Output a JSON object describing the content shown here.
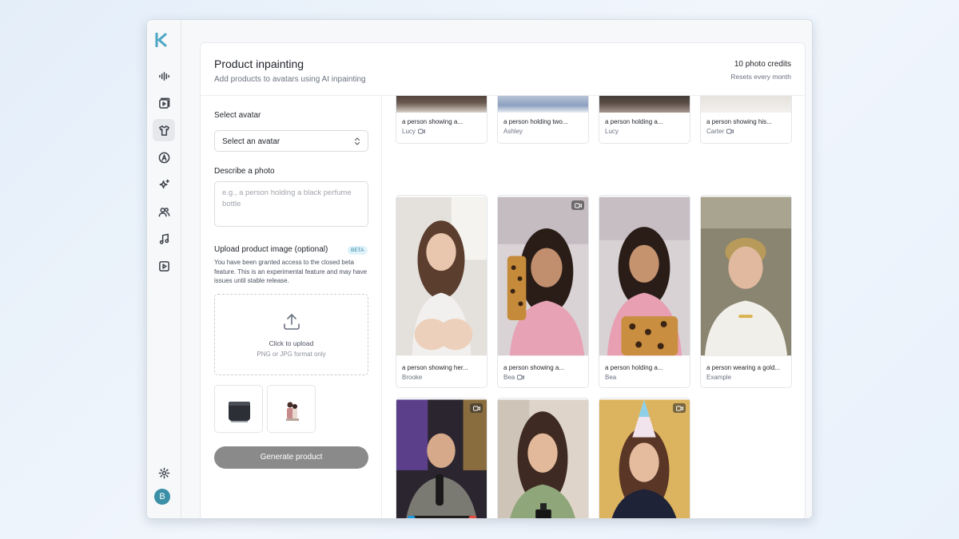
{
  "header": {
    "title": "Product inpainting",
    "subtitle": "Add products to avatars using AI inpainting",
    "credits": "10 photo credits",
    "credits_reset": "Resets every month"
  },
  "sidebar": {
    "items": [
      {
        "icon": "waveform-icon"
      },
      {
        "icon": "video-library-icon"
      },
      {
        "icon": "shirt-icon",
        "active": true
      },
      {
        "icon": "avatar-a-icon"
      },
      {
        "icon": "sparkles-icon"
      },
      {
        "icon": "users-icon"
      },
      {
        "icon": "music-icon"
      },
      {
        "icon": "play-square-icon"
      }
    ],
    "settings_icon": "gear-icon",
    "user_initial": "B"
  },
  "form": {
    "avatar_label": "Select avatar",
    "avatar_placeholder": "Select an avatar",
    "describe_label": "Describe a photo",
    "describe_placeholder": "e.g., a person holding a black perfume bottle",
    "upload_label": "Upload product image (optional)",
    "beta_badge": "BETA",
    "beta_note": "You have been granted access to the closed beta feature. This is an experimental feature and may have issues until stable release.",
    "upload_cta": "Click to upload",
    "upload_formats": "PNG or JPG format only",
    "generate_label": "Generate product"
  },
  "gallery": {
    "top_row": [
      {
        "caption": "a person showing a...",
        "name": "Lucy",
        "video": true
      },
      {
        "caption": "a person holding two...",
        "name": "Ashley",
        "video": false
      },
      {
        "caption": "a person holding a...",
        "name": "Lucy",
        "video": false
      },
      {
        "caption": "a person showing his...",
        "name": "Carter",
        "video": true
      }
    ],
    "middle_row": [
      {
        "caption": "a person showing her...",
        "name": "Brooke",
        "video": false
      },
      {
        "caption": "a person showing a...",
        "name": "Bea",
        "video": true
      },
      {
        "caption": "a person holding a...",
        "name": "Bea",
        "video": false
      },
      {
        "caption": "a person wearing a gold...",
        "name": "Example",
        "video": false
      }
    ],
    "bottom_row": [
      {
        "video": true
      },
      {
        "video": false
      },
      {
        "video": true
      }
    ]
  },
  "colors": {
    "accent": "#3b8fa6",
    "button_disabled": "#8a8a8a",
    "beta_bg": "#e0f2fa"
  }
}
